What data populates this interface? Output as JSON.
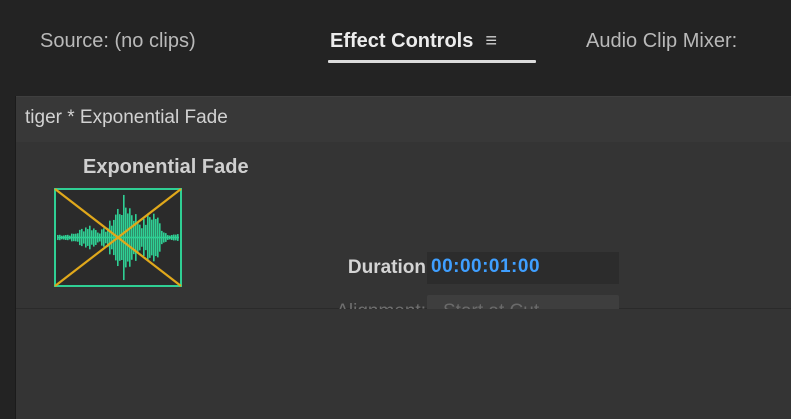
{
  "tabs": [
    {
      "label": "Source: (no clips)",
      "active": false
    },
    {
      "label": "Effect Controls",
      "active": true
    },
    {
      "label": "Audio Clip Mixer:",
      "active": false
    }
  ],
  "tab_menu_icon": "hamburger-menu-icon",
  "clip_header": {
    "title": "tiger * Exponential Fade"
  },
  "effect": {
    "name": "Exponential Fade",
    "thumbnail_icon": "audio-waveform-crossfade-icon",
    "duration_label": "Duration",
    "duration_value": "00:00:01:00",
    "alignment_label": "Alignment:",
    "alignment_value": "Start at Cut"
  },
  "colors": {
    "background": "#232323",
    "panel": "#343434",
    "header": "#383838",
    "timecode": "#3f9fff",
    "waveform": "#2fcf94",
    "cross_lines": "#e0a81b"
  }
}
